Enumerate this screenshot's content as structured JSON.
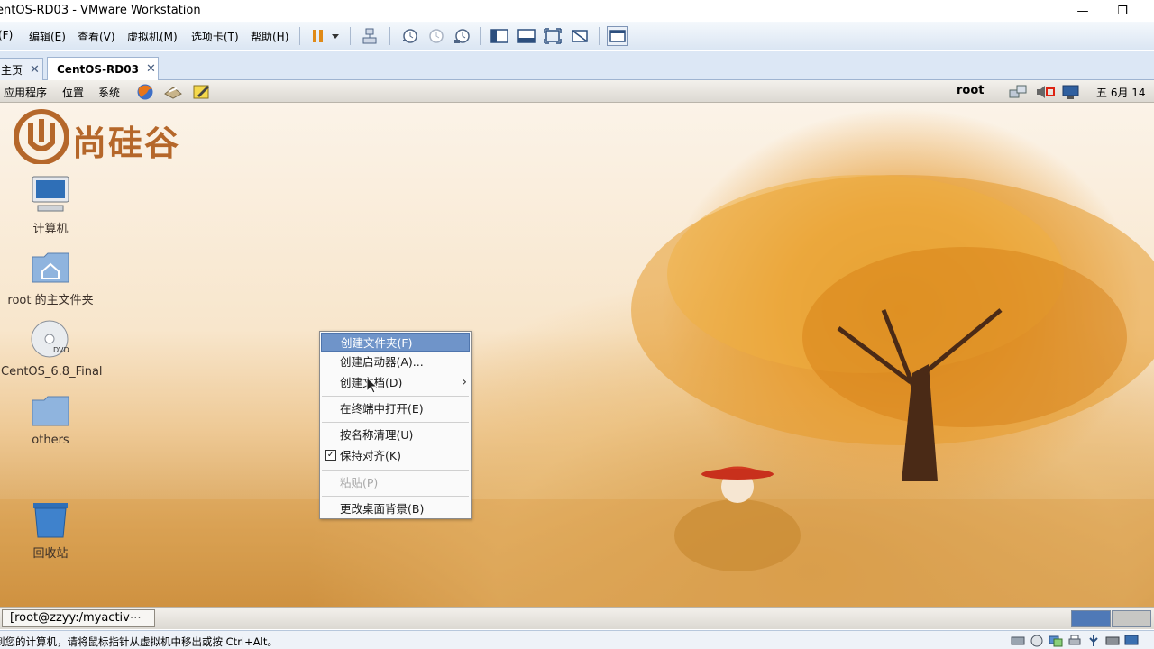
{
  "window": {
    "title": "entOS-RD03 - VMware Workstation",
    "minimize": "—",
    "restore": "❐"
  },
  "menubar": {
    "file": "(F)",
    "edit": "编辑(E)",
    "view": "查看(V)",
    "vm": "虚拟机(M)",
    "tabs": "选项卡(T)",
    "help": "帮助(H)"
  },
  "tabs": [
    {
      "label": "主页"
    },
    {
      "label": "CentOS-RD03"
    }
  ],
  "guest_panel": {
    "applications": "应用程序",
    "places": "位置",
    "system": "系统",
    "user": "root",
    "clock": "五 6月 14"
  },
  "desktop": {
    "logo_text": "尚硅谷",
    "icons": [
      {
        "label": "计算机"
      },
      {
        "label": "root 的主文件夹"
      },
      {
        "label": "CentOS_6.8_Final"
      },
      {
        "label": "others"
      },
      {
        "label": "回收站"
      }
    ]
  },
  "context_menu": {
    "items": [
      {
        "label": "创建文件夹(F)"
      },
      {
        "label": "创建启动器(A)..."
      },
      {
        "label": "创建文档(D)"
      },
      {
        "label": "在终端中打开(E)"
      },
      {
        "label": "按名称清理(U)"
      },
      {
        "label": "保持对齐(K)",
        "checked": true
      },
      {
        "label": "粘贴(P)",
        "disabled": true
      },
      {
        "label": "更改桌面背景(B)"
      }
    ]
  },
  "taskbar": {
    "window_button": "[root@zzyy:/myactiv⋯"
  },
  "statusbar": {
    "message": "到您的计算机，请将鼠标指针从虚拟机中移出或按 Ctrl+Alt。"
  }
}
